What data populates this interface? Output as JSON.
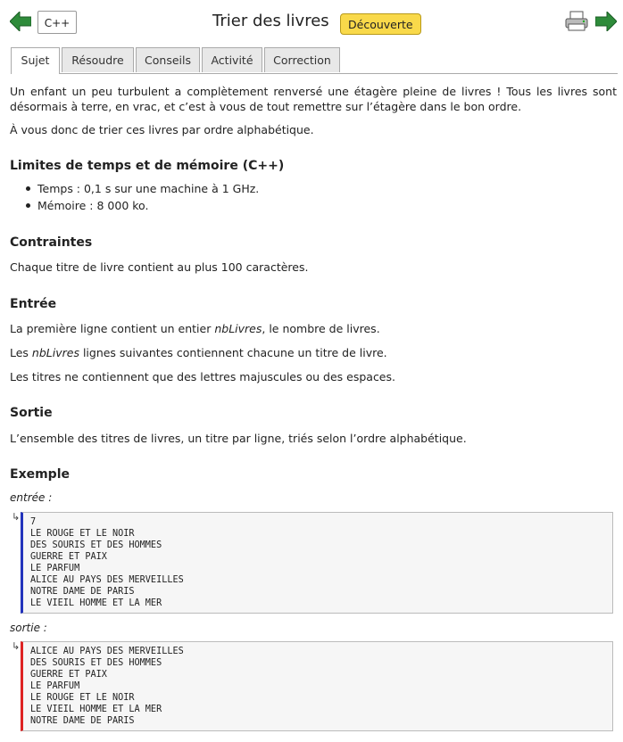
{
  "header": {
    "lang_button": "C++",
    "title": "Trier des livres",
    "badge": "Découverte",
    "back_icon": "arrow-left-icon",
    "print_icon": "printer-icon",
    "next_icon": "arrow-right-icon",
    "arrow_color": "#2e8b3a",
    "badge_color": "#f9d94a"
  },
  "tabs": [
    {
      "label": "Sujet",
      "active": true
    },
    {
      "label": "Résoudre",
      "active": false
    },
    {
      "label": "Conseils",
      "active": false
    },
    {
      "label": "Activité",
      "active": false
    },
    {
      "label": "Correction",
      "active": false
    }
  ],
  "intro": {
    "p1": "Un enfant un peu turbulent a complètement renversé une étagère pleine de livres ! Tous les livres sont désormais à terre, en vrac, et c’est à vous de tout remettre sur l’étagère dans le bon ordre.",
    "p2": "À vous donc de trier ces livres par ordre alphabétique."
  },
  "limits": {
    "heading": "Limites de temps et de mémoire (C++)",
    "items": [
      "Temps : 0,1 s sur une machine à 1 GHz.",
      "Mémoire : 8 000 ko."
    ]
  },
  "constraints": {
    "heading": "Contraintes",
    "text": "Chaque titre de livre contient au plus 100 caractères."
  },
  "input": {
    "heading": "Entrée",
    "l1_before": "La première ligne contient un entier ",
    "l1_var": "nbLivres",
    "l1_after": ", le nombre de livres.",
    "l2_before": "Les ",
    "l2_var": "nbLivres",
    "l2_after": " lignes suivantes contiennent chacune un titre de livre.",
    "l3": "Les titres ne contiennent que des lettres majuscules ou des espaces."
  },
  "output": {
    "heading": "Sortie",
    "text": "L’ensemble des titres de livres, un titre par ligne, triés selon l’ordre alphabétique."
  },
  "example": {
    "heading": "Exemple",
    "input_label": "entrée :",
    "output_label": "sortie :",
    "return_glyph": "↳",
    "input_lines": [
      "7",
      "LE ROUGE ET LE NOIR",
      "DES SOURIS ET DES HOMMES",
      "GUERRE ET PAIX",
      "LE PARFUM",
      "ALICE AU PAYS DES MERVEILLES",
      "NOTRE DAME DE PARIS",
      "LE VIEIL HOMME ET LA MER"
    ],
    "output_lines": [
      "ALICE AU PAYS DES MERVEILLES",
      "DES SOURIS ET DES HOMMES",
      "GUERRE ET PAIX",
      "LE PARFUM",
      "LE ROUGE ET LE NOIR",
      "LE VIEIL HOMME ET LA MER",
      "NOTRE DAME DE PARIS"
    ]
  }
}
